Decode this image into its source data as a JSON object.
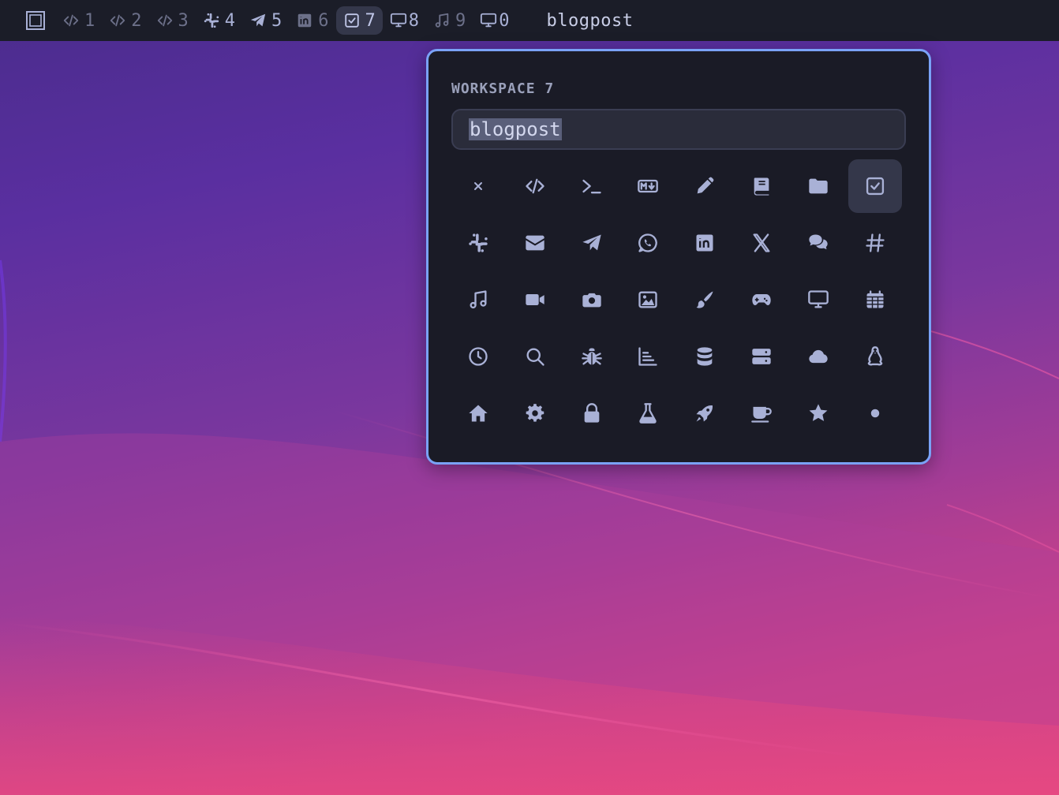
{
  "topbar": {
    "workspaces": [
      {
        "icon": "code-icon",
        "label": "1",
        "state": "dim"
      },
      {
        "icon": "code-icon",
        "label": "2",
        "state": "dim"
      },
      {
        "icon": "code-icon",
        "label": "3",
        "state": "dim"
      },
      {
        "icon": "slack-icon",
        "label": "4",
        "state": "normal"
      },
      {
        "icon": "telegram-icon",
        "label": "5",
        "state": "normal"
      },
      {
        "icon": "linkedin-icon",
        "label": "6",
        "state": "dim"
      },
      {
        "icon": "checkbox-icon",
        "label": "7",
        "state": "active"
      },
      {
        "icon": "desktop-icon",
        "label": "8",
        "state": "normal"
      },
      {
        "icon": "music-icon",
        "label": "9",
        "state": "dim"
      },
      {
        "icon": "desktop-icon",
        "label": "0",
        "state": "normal"
      }
    ],
    "window_title": "blogpost"
  },
  "popup": {
    "heading": "WORKSPACE 7",
    "name_value": "blogpost",
    "selected_icon": "checkbox-icon",
    "icons": [
      "close-icon",
      "code-icon",
      "terminal-icon",
      "markdown-icon",
      "pencil-icon",
      "book-icon",
      "folder-icon",
      "checkbox-icon",
      "slack-icon",
      "envelope-icon",
      "telegram-icon",
      "whatsapp-icon",
      "linkedin-icon",
      "x-icon",
      "comments-icon",
      "hashtag-icon",
      "music-icon",
      "video-icon",
      "camera-icon",
      "image-icon",
      "paintbrush-icon",
      "gamepad-icon",
      "desktop-icon",
      "calendar-icon",
      "clock-icon",
      "search-icon",
      "bug-icon",
      "chart-icon",
      "database-icon",
      "server-icon",
      "cloud-icon",
      "linux-icon",
      "home-icon",
      "gear-icon",
      "lock-icon",
      "flask-icon",
      "rocket-icon",
      "coffee-icon",
      "star-icon",
      "dot-icon"
    ]
  },
  "colors": {
    "bar_bg": "#1b1d28",
    "popup_bg": "#1a1b26",
    "popup_border": "#7aa2f7",
    "icon_fg": "#a9b1d6",
    "selected_bg": "#34374a"
  }
}
